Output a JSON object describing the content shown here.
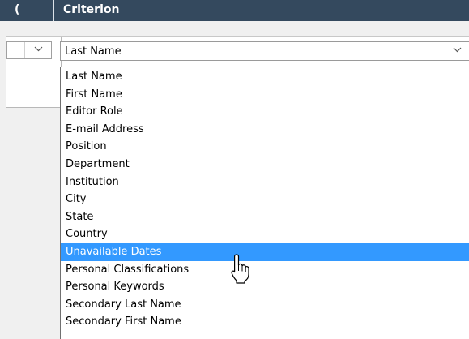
{
  "header": {
    "paren_label": "(",
    "criterion_label": "Criterion"
  },
  "criterion_select": {
    "selected_value": "Last Name"
  },
  "dropdown": {
    "highlighted_index": 10,
    "options": [
      "Last Name",
      "First Name",
      "Editor Role",
      "E-mail Address",
      "Position",
      "Department",
      "Institution",
      "City",
      "State",
      "Country",
      "Unavailable Dates",
      "Personal Classifications",
      "Personal Keywords",
      "Secondary Last Name",
      "Secondary First Name"
    ]
  },
  "colors": {
    "header_bg": "#34495e",
    "highlight_bg": "#3399ff"
  },
  "icons": {
    "select_arrow": "chevron-down-icon",
    "cursor": "hand-pointer-icon"
  }
}
